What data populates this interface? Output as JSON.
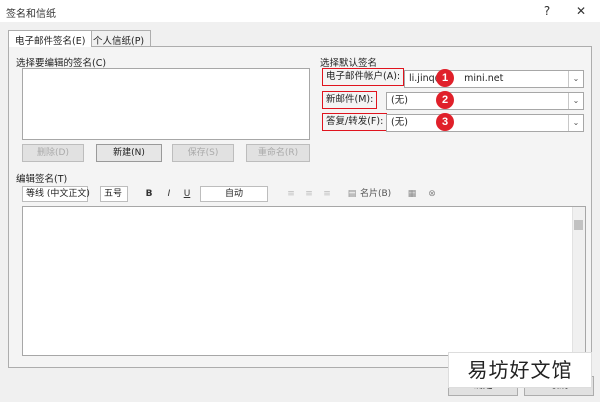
{
  "window": {
    "title": "签名和信纸",
    "help": "?",
    "close": "✕"
  },
  "tabs": [
    {
      "label": "电子邮件签名(E)"
    },
    {
      "label": "个人信纸(P)"
    }
  ],
  "left": {
    "list_label": "选择要编辑的签名(C)",
    "buttons": {
      "delete": "删除(D)",
      "new": "新建(N)",
      "save": "保存(S)",
      "rename": "重命名(R)"
    }
  },
  "right": {
    "section_label": "选择默认签名",
    "account_label": "电子邮件帐户(A):",
    "account_value": "li.jinq@",
    "account_value_tail": "mini.net",
    "new_msg_label": "新邮件(M):",
    "new_msg_value": "(无)",
    "reply_label": "答复/转发(F):",
    "reply_value": "(无)",
    "badges": [
      "1",
      "2",
      "3"
    ],
    "annotation_color": "#e0141e"
  },
  "editor": {
    "label": "编辑签名(T)",
    "font": "等线 (中文正文)",
    "size": "五号",
    "bold": "B",
    "italic": "I",
    "underline": "U",
    "color": "自动",
    "business_card": "名片(B)"
  },
  "footer": {
    "ok": "确定",
    "cancel": "取消"
  },
  "watermark": "易坊好文馆"
}
